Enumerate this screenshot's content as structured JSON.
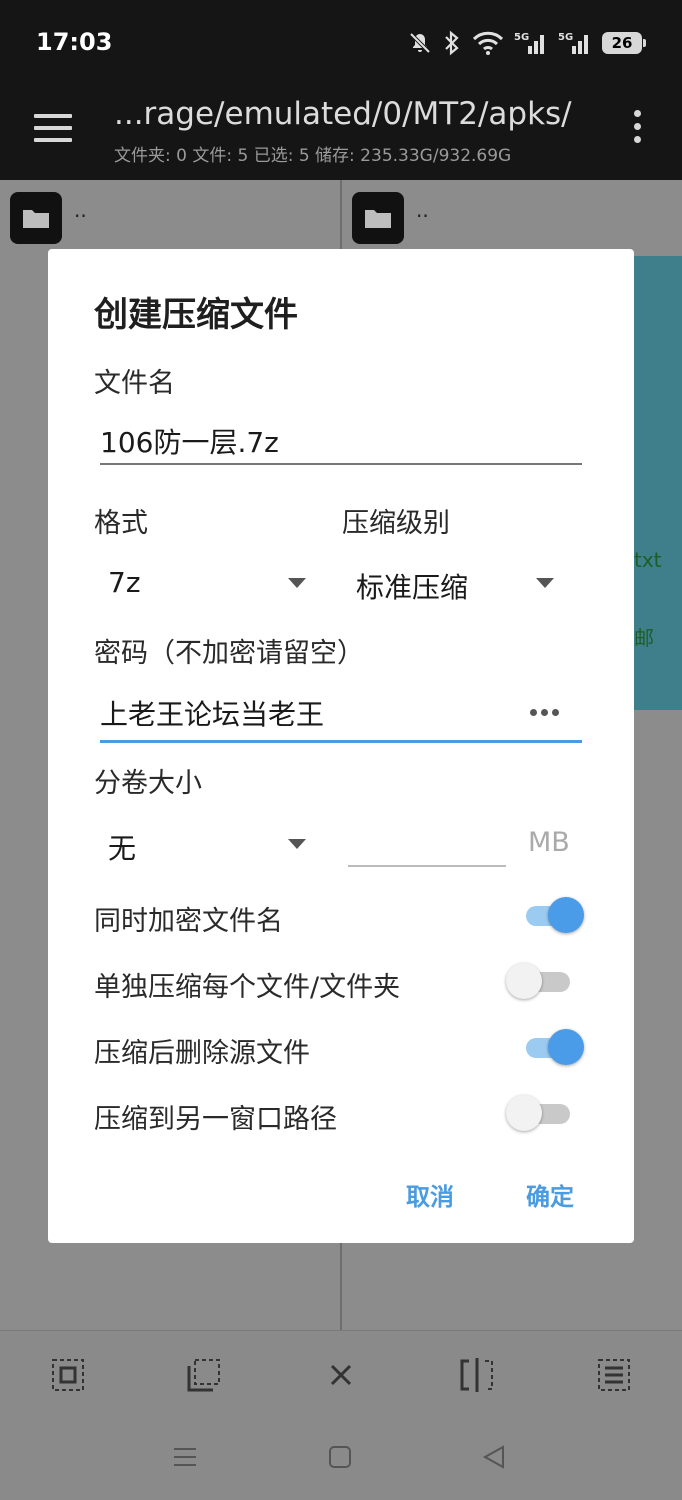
{
  "status_bar": {
    "time": "17:03",
    "battery": "26",
    "icons": [
      "mute-icon",
      "bluetooth-icon",
      "wifi-icon",
      "signal-5g-icon",
      "signal-5g-icon"
    ]
  },
  "header": {
    "path": "...rage/emulated/0/MT2/apks/",
    "info": "文件夹: 0  文件: 5  已选: 5  储存: 235.33G/932.69G"
  },
  "panes": {
    "left_folder": "..",
    "right_folder": "..",
    "partial_text_1": "txt",
    "partial_text_2": "邮"
  },
  "dialog": {
    "title": "创建压缩文件",
    "filename_label": "文件名",
    "filename_value": "106防一层.7z",
    "format_label": "格式",
    "format_value": "7z",
    "level_label": "压缩级别",
    "level_value": "标准压缩",
    "password_label": "密码（不加密请留空）",
    "password_value": "上老王论坛当老王",
    "split_label": "分卷大小",
    "split_value": "无",
    "split_size_value": "",
    "split_unit": "MB",
    "options": [
      {
        "label": "同时加密文件名",
        "on": true
      },
      {
        "label": "单独压缩每个文件/文件夹",
        "on": false
      },
      {
        "label": "压缩后删除源文件",
        "on": true
      },
      {
        "label": "压缩到另一窗口路径",
        "on": false
      }
    ],
    "cancel": "取消",
    "ok": "确定"
  },
  "colors": {
    "accent": "#4a9be0",
    "header_bg": "#151515",
    "dim_bg": "#8a8a8a"
  }
}
